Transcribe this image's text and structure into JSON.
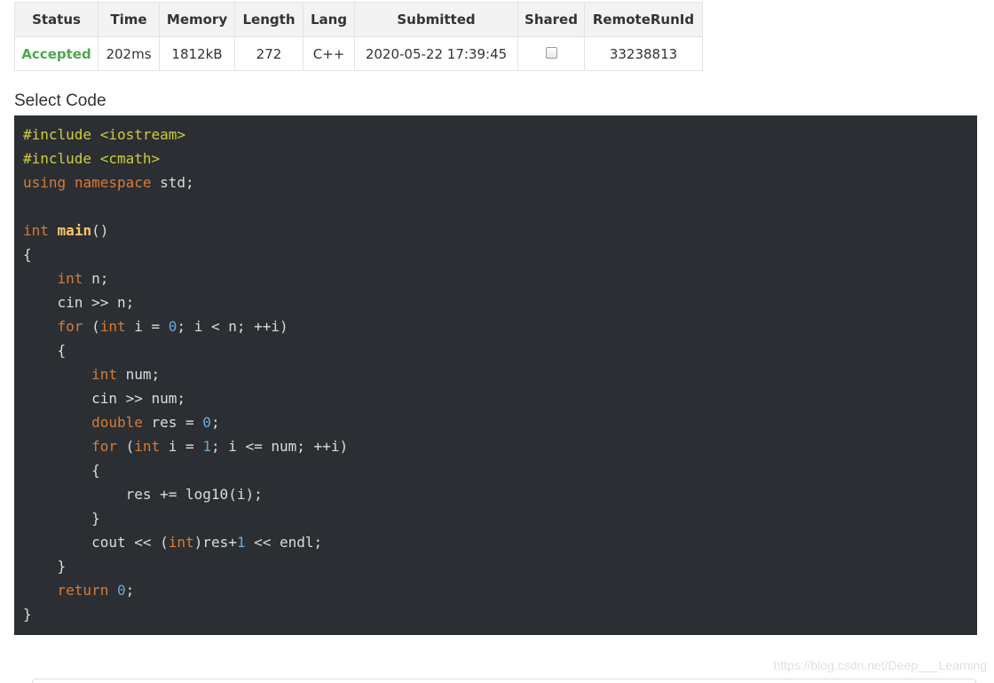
{
  "submission_table": {
    "headers": [
      "Status",
      "Time",
      "Memory",
      "Length",
      "Lang",
      "Submitted",
      "Shared",
      "RemoteRunId"
    ],
    "row": {
      "status": "Accepted",
      "time": "202ms",
      "memory": "1812kB",
      "length": "272",
      "lang": "C++",
      "submitted": "2020-05-22 17:39:45",
      "shared": false,
      "remote_run_id": "33238813"
    },
    "colors": {
      "accepted": "#4ea84e",
      "header_bg": "#f3f3f3",
      "border": "#e4e4e4"
    }
  },
  "code_section": {
    "label": "Select Code",
    "background": "#2b2f33",
    "lines": [
      [
        {
          "t": "#include <iostream>",
          "c": "pre"
        }
      ],
      [
        {
          "t": "#include <cmath>",
          "c": "pre"
        }
      ],
      [
        {
          "t": "using",
          "c": "kw"
        },
        {
          "t": " "
        },
        {
          "t": "namespace",
          "c": "kw"
        },
        {
          "t": " std;"
        }
      ],
      [],
      [
        {
          "t": "int",
          "c": "kw"
        },
        {
          "t": " "
        },
        {
          "t": "main",
          "c": "fn"
        },
        {
          "t": "()"
        }
      ],
      [
        {
          "t": "{"
        }
      ],
      [
        {
          "t": "    "
        },
        {
          "t": "int",
          "c": "kw"
        },
        {
          "t": " n;"
        }
      ],
      [
        {
          "t": "    cin >> n;"
        }
      ],
      [
        {
          "t": "    "
        },
        {
          "t": "for",
          "c": "kw"
        },
        {
          "t": " ("
        },
        {
          "t": "int",
          "c": "kw"
        },
        {
          "t": " i = "
        },
        {
          "t": "0",
          "c": "num"
        },
        {
          "t": "; i < n; ++i)"
        }
      ],
      [
        {
          "t": "    {"
        }
      ],
      [
        {
          "t": "        "
        },
        {
          "t": "int",
          "c": "kw"
        },
        {
          "t": " num;"
        }
      ],
      [
        {
          "t": "        cin >> num;"
        }
      ],
      [
        {
          "t": "        "
        },
        {
          "t": "double",
          "c": "kw"
        },
        {
          "t": " res = "
        },
        {
          "t": "0",
          "c": "num"
        },
        {
          "t": ";"
        }
      ],
      [
        {
          "t": "        "
        },
        {
          "t": "for",
          "c": "kw"
        },
        {
          "t": " ("
        },
        {
          "t": "int",
          "c": "kw"
        },
        {
          "t": " i = "
        },
        {
          "t": "1",
          "c": "num"
        },
        {
          "t": "; i <= num; ++i)"
        }
      ],
      [
        {
          "t": "        {"
        }
      ],
      [
        {
          "t": "            res += log10(i);"
        }
      ],
      [
        {
          "t": "        }"
        }
      ],
      [
        {
          "t": "        cout << ("
        },
        {
          "t": "int",
          "c": "kw"
        },
        {
          "t": ")res+"
        },
        {
          "t": "1",
          "c": "num"
        },
        {
          "t": " << endl;"
        }
      ],
      [
        {
          "t": "    }"
        }
      ],
      [
        {
          "t": "    "
        },
        {
          "t": "return",
          "c": "kw"
        },
        {
          "t": " "
        },
        {
          "t": "0",
          "c": "num"
        },
        {
          "t": ";"
        }
      ],
      [
        {
          "t": "}"
        }
      ]
    ]
  },
  "watermark": {
    "text": "https://blog.csdn.net/Deep___Learning"
  }
}
